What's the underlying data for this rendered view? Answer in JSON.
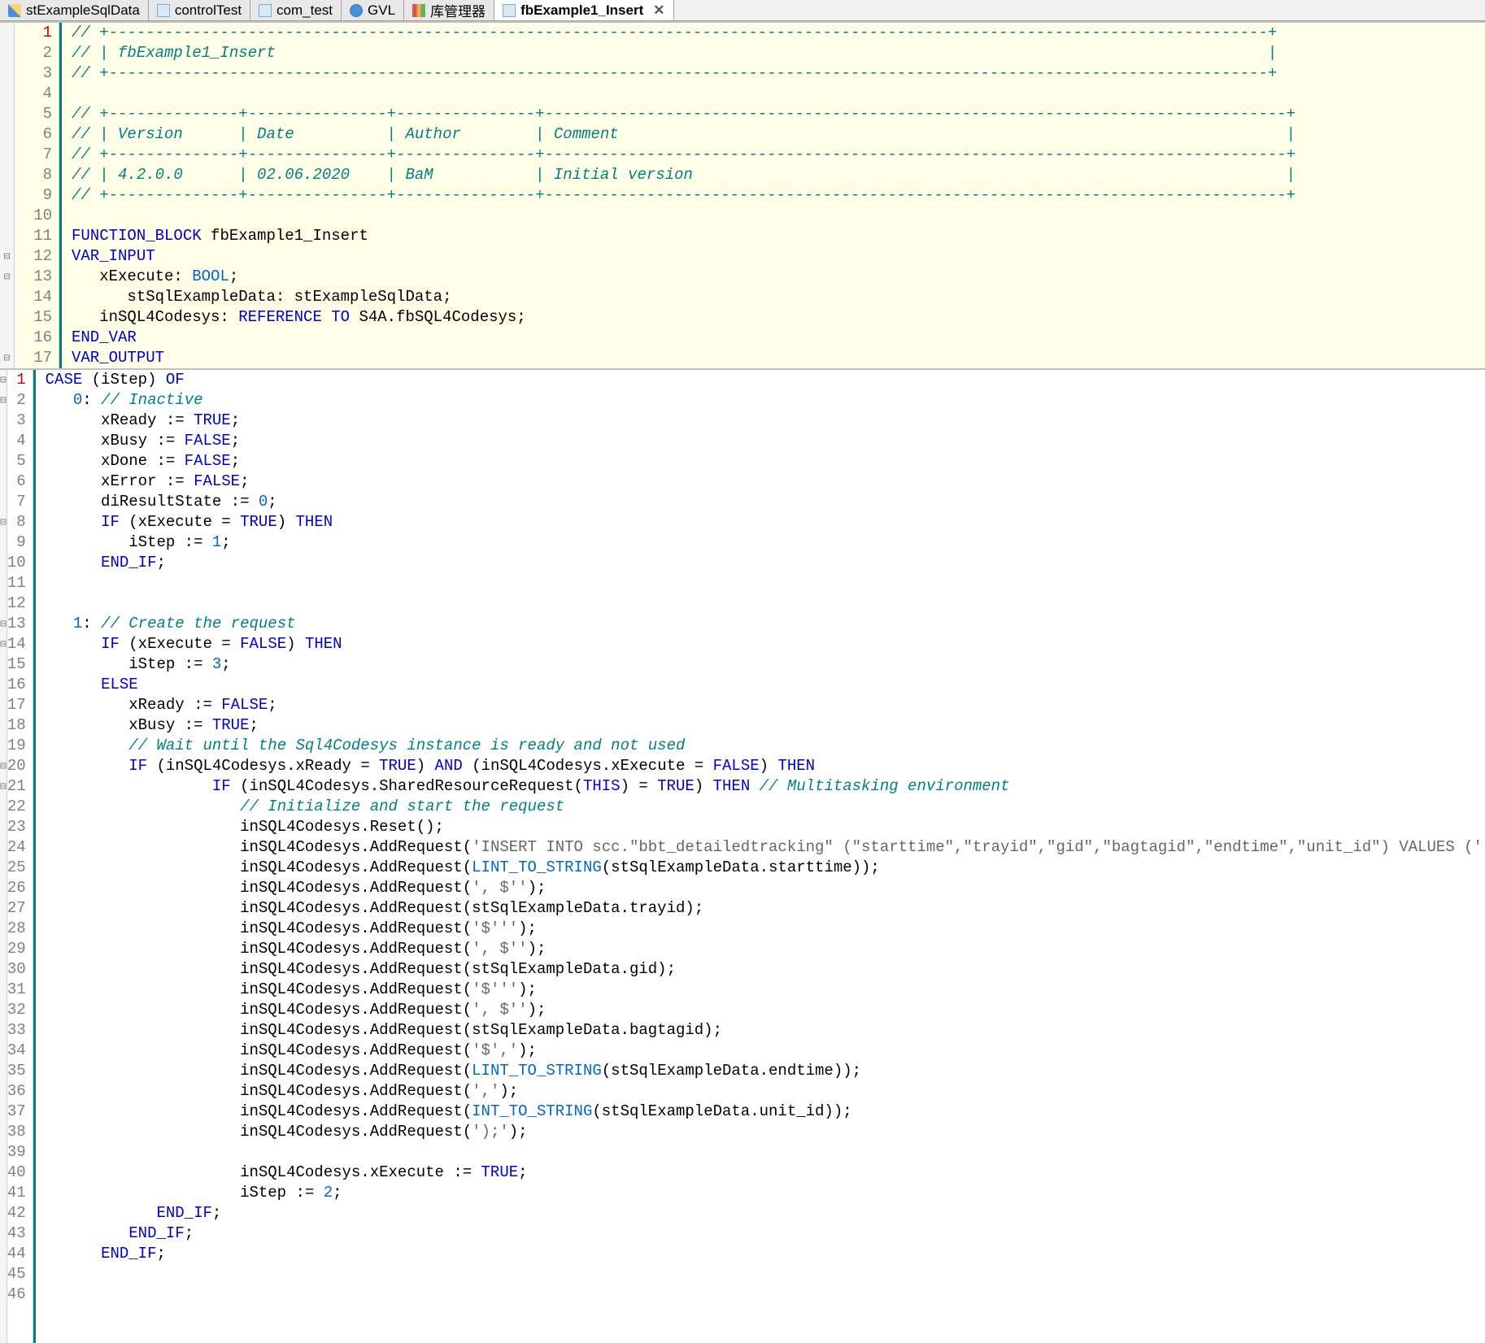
{
  "tabs": [
    {
      "label": "stExampleSqlData",
      "icon": "struct"
    },
    {
      "label": "controlTest",
      "icon": "file"
    },
    {
      "label": "com_test",
      "icon": "file"
    },
    {
      "label": "GVL",
      "icon": "globe"
    },
    {
      "label": "库管理器",
      "icon": "lib"
    },
    {
      "label": "fbExample1_Insert",
      "icon": "file",
      "active": true
    }
  ],
  "topPane": {
    "lines": [
      {
        "n": 1,
        "current": true,
        "fold": "",
        "tokens": [
          {
            "t": "// +-----------------------------------------------------------------------------------------------------------------------------+",
            "c": "comment-it"
          }
        ]
      },
      {
        "n": 2,
        "tokens": [
          {
            "t": "// | fbExample1_Insert                                                                                                           |",
            "c": "comment-it"
          }
        ]
      },
      {
        "n": 3,
        "tokens": [
          {
            "t": "// +-----------------------------------------------------------------------------------------------------------------------------+",
            "c": "comment-it"
          }
        ]
      },
      {
        "n": 4,
        "tokens": []
      },
      {
        "n": 5,
        "tokens": [
          {
            "t": "// +--------------+---------------+---------------+--------------------------------------------------------------------------------+",
            "c": "comment-it"
          }
        ]
      },
      {
        "n": 6,
        "tokens": [
          {
            "t": "// | Version      | Date          | Author        | Comment                                                                        |",
            "c": "comment-it"
          }
        ]
      },
      {
        "n": 7,
        "tokens": [
          {
            "t": "// +--------------+---------------+---------------+--------------------------------------------------------------------------------+",
            "c": "comment-it"
          }
        ]
      },
      {
        "n": 8,
        "tokens": [
          {
            "t": "// | 4.2.0.0      | 02.06.2020    | BaM           | Initial version                                                                |",
            "c": "comment-it"
          }
        ]
      },
      {
        "n": 9,
        "tokens": [
          {
            "t": "// +--------------+---------------+---------------+--------------------------------------------------------------------------------+",
            "c": "comment-it"
          }
        ]
      },
      {
        "n": 10,
        "tokens": []
      },
      {
        "n": 11,
        "tokens": [
          {
            "t": "FUNCTION_BLOCK",
            "c": "kw"
          },
          {
            "t": " fbExample1_Insert",
            "c": "plain"
          }
        ]
      },
      {
        "n": 12,
        "fold": "⊟",
        "tokens": [
          {
            "t": "VAR_INPUT",
            "c": "kw"
          }
        ]
      },
      {
        "n": 13,
        "fold": "⊟",
        "tokens": [
          {
            "t": "   xExecute: ",
            "c": "plain"
          },
          {
            "t": "BOOL",
            "c": "type"
          },
          {
            "t": ";",
            "c": "plain"
          }
        ]
      },
      {
        "n": 14,
        "tokens": [
          {
            "t": "      stSqlExampleData: stExampleSqlData;",
            "c": "plain"
          }
        ]
      },
      {
        "n": 15,
        "tokens": [
          {
            "t": "   inSQL4Codesys: ",
            "c": "plain"
          },
          {
            "t": "REFERENCE TO",
            "c": "kw"
          },
          {
            "t": " S4A.fbSQL4Codesys;",
            "c": "plain"
          }
        ]
      },
      {
        "n": 16,
        "tokens": [
          {
            "t": "END_VAR",
            "c": "kw"
          }
        ]
      },
      {
        "n": 17,
        "fold": "⊟",
        "tokens": [
          {
            "t": "VAR_OUTPUT",
            "c": "kw"
          }
        ]
      }
    ]
  },
  "bottomPane": {
    "lines": [
      {
        "n": 1,
        "current": true,
        "fold": "⊟",
        "tokens": [
          {
            "t": "CASE",
            "c": "kw"
          },
          {
            "t": " (iStep) ",
            "c": "plain"
          },
          {
            "t": "OF",
            "c": "kw"
          }
        ]
      },
      {
        "n": 2,
        "fold": "⊟",
        "tokens": [
          {
            "t": "   ",
            "c": "plain"
          },
          {
            "t": "0",
            "c": "num"
          },
          {
            "t": ": ",
            "c": "plain"
          },
          {
            "t": "// Inactive",
            "c": "comment-it"
          }
        ]
      },
      {
        "n": 3,
        "tokens": [
          {
            "t": "      xReady := ",
            "c": "plain"
          },
          {
            "t": "TRUE",
            "c": "bool"
          },
          {
            "t": ";",
            "c": "plain"
          }
        ]
      },
      {
        "n": 4,
        "tokens": [
          {
            "t": "      xBusy := ",
            "c": "plain"
          },
          {
            "t": "FALSE",
            "c": "bool"
          },
          {
            "t": ";",
            "c": "plain"
          }
        ]
      },
      {
        "n": 5,
        "tokens": [
          {
            "t": "      xDone := ",
            "c": "plain"
          },
          {
            "t": "FALSE",
            "c": "bool"
          },
          {
            "t": ";",
            "c": "plain"
          }
        ]
      },
      {
        "n": 6,
        "tokens": [
          {
            "t": "      xError := ",
            "c": "plain"
          },
          {
            "t": "FALSE",
            "c": "bool"
          },
          {
            "t": ";",
            "c": "plain"
          }
        ]
      },
      {
        "n": 7,
        "tokens": [
          {
            "t": "      diResultState := ",
            "c": "plain"
          },
          {
            "t": "0",
            "c": "num"
          },
          {
            "t": ";",
            "c": "plain"
          }
        ]
      },
      {
        "n": 8,
        "fold": "⊟",
        "tokens": [
          {
            "t": "      ",
            "c": "plain"
          },
          {
            "t": "IF",
            "c": "kw"
          },
          {
            "t": " (xExecute = ",
            "c": "plain"
          },
          {
            "t": "TRUE",
            "c": "bool"
          },
          {
            "t": ") ",
            "c": "plain"
          },
          {
            "t": "THEN",
            "c": "kw"
          }
        ]
      },
      {
        "n": 9,
        "tokens": [
          {
            "t": "         iStep := ",
            "c": "plain"
          },
          {
            "t": "1",
            "c": "num"
          },
          {
            "t": ";",
            "c": "plain"
          }
        ]
      },
      {
        "n": 10,
        "tokens": [
          {
            "t": "      ",
            "c": "plain"
          },
          {
            "t": "END_IF",
            "c": "kw"
          },
          {
            "t": ";",
            "c": "plain"
          }
        ]
      },
      {
        "n": 11,
        "tokens": []
      },
      {
        "n": 12,
        "tokens": []
      },
      {
        "n": 13,
        "fold": "⊟",
        "tokens": [
          {
            "t": "   ",
            "c": "plain"
          },
          {
            "t": "1",
            "c": "num"
          },
          {
            "t": ": ",
            "c": "plain"
          },
          {
            "t": "// Create the request",
            "c": "comment-it"
          }
        ]
      },
      {
        "n": 14,
        "fold": "⊟",
        "tokens": [
          {
            "t": "      ",
            "c": "plain"
          },
          {
            "t": "IF",
            "c": "kw"
          },
          {
            "t": " (xExecute = ",
            "c": "plain"
          },
          {
            "t": "FALSE",
            "c": "bool"
          },
          {
            "t": ") ",
            "c": "plain"
          },
          {
            "t": "THEN",
            "c": "kw"
          }
        ]
      },
      {
        "n": 15,
        "tokens": [
          {
            "t": "         iStep := ",
            "c": "plain"
          },
          {
            "t": "3",
            "c": "num"
          },
          {
            "t": ";",
            "c": "plain"
          }
        ]
      },
      {
        "n": 16,
        "tokens": [
          {
            "t": "      ",
            "c": "plain"
          },
          {
            "t": "ELSE",
            "c": "kw"
          }
        ]
      },
      {
        "n": 17,
        "tokens": [
          {
            "t": "         xReady := ",
            "c": "plain"
          },
          {
            "t": "FALSE",
            "c": "bool"
          },
          {
            "t": ";",
            "c": "plain"
          }
        ]
      },
      {
        "n": 18,
        "tokens": [
          {
            "t": "         xBusy := ",
            "c": "plain"
          },
          {
            "t": "TRUE",
            "c": "bool"
          },
          {
            "t": ";",
            "c": "plain"
          }
        ]
      },
      {
        "n": 19,
        "tokens": [
          {
            "t": "         ",
            "c": "plain"
          },
          {
            "t": "// Wait until the Sql4Codesys instance is ready and not used",
            "c": "comment-it"
          }
        ]
      },
      {
        "n": 20,
        "fold": "⊟",
        "tokens": [
          {
            "t": "         ",
            "c": "plain"
          },
          {
            "t": "IF",
            "c": "kw"
          },
          {
            "t": " (inSQL4Codesys.xReady = ",
            "c": "plain"
          },
          {
            "t": "TRUE",
            "c": "bool"
          },
          {
            "t": ") ",
            "c": "plain"
          },
          {
            "t": "AND",
            "c": "kw"
          },
          {
            "t": " (inSQL4Codesys.xExecute = ",
            "c": "plain"
          },
          {
            "t": "FALSE",
            "c": "bool"
          },
          {
            "t": ") ",
            "c": "plain"
          },
          {
            "t": "THEN",
            "c": "kw"
          }
        ]
      },
      {
        "n": 21,
        "fold": "⊟",
        "tokens": [
          {
            "t": "                  ",
            "c": "plain"
          },
          {
            "t": "IF",
            "c": "kw"
          },
          {
            "t": " (inSQL4Codesys.SharedResourceRequest(",
            "c": "plain"
          },
          {
            "t": "THIS",
            "c": "kw"
          },
          {
            "t": ") = ",
            "c": "plain"
          },
          {
            "t": "TRUE",
            "c": "bool"
          },
          {
            "t": ") ",
            "c": "plain"
          },
          {
            "t": "THEN",
            "c": "kw"
          },
          {
            "t": " ",
            "c": "plain"
          },
          {
            "t": "// Multitasking environment",
            "c": "comment-it"
          }
        ]
      },
      {
        "n": 22,
        "tokens": [
          {
            "t": "                     ",
            "c": "plain"
          },
          {
            "t": "// Initialize and start the request",
            "c": "comment-it"
          }
        ]
      },
      {
        "n": 23,
        "tokens": [
          {
            "t": "                     inSQL4Codesys.Reset();",
            "c": "plain"
          }
        ]
      },
      {
        "n": 24,
        "tokens": [
          {
            "t": "                     inSQL4Codesys.AddRequest(",
            "c": "plain"
          },
          {
            "t": "'INSERT INTO scc.\"bbt_detailedtracking\" (\"starttime\",\"trayid\",\"gid\",\"bagtagid\",\"endtime\",\"unit_id\") VALUES ('",
            "c": "str"
          },
          {
            "t": ");",
            "c": "plain"
          }
        ]
      },
      {
        "n": 25,
        "tokens": [
          {
            "t": "                     inSQL4Codesys.AddRequest(",
            "c": "plain"
          },
          {
            "t": "LINT_TO_STRING",
            "c": "func"
          },
          {
            "t": "(stSqlExampleData.starttime));",
            "c": "plain"
          }
        ]
      },
      {
        "n": 26,
        "tokens": [
          {
            "t": "                     inSQL4Codesys.AddRequest(",
            "c": "plain"
          },
          {
            "t": "', $''",
            "c": "str"
          },
          {
            "t": ");",
            "c": "plain"
          }
        ]
      },
      {
        "n": 27,
        "tokens": [
          {
            "t": "                     inSQL4Codesys.AddRequest(stSqlExampleData.trayid);",
            "c": "plain"
          }
        ]
      },
      {
        "n": 28,
        "tokens": [
          {
            "t": "                     inSQL4Codesys.AddRequest(",
            "c": "plain"
          },
          {
            "t": "'$'''",
            "c": "str"
          },
          {
            "t": ");",
            "c": "plain"
          }
        ]
      },
      {
        "n": 29,
        "tokens": [
          {
            "t": "                     inSQL4Codesys.AddRequest(",
            "c": "plain"
          },
          {
            "t": "', $''",
            "c": "str"
          },
          {
            "t": ");",
            "c": "plain"
          }
        ]
      },
      {
        "n": 30,
        "tokens": [
          {
            "t": "                     inSQL4Codesys.AddRequest(stSqlExampleData.gid);",
            "c": "plain"
          }
        ]
      },
      {
        "n": 31,
        "tokens": [
          {
            "t": "                     inSQL4Codesys.AddRequest(",
            "c": "plain"
          },
          {
            "t": "'$'''",
            "c": "str"
          },
          {
            "t": ");",
            "c": "plain"
          }
        ]
      },
      {
        "n": 32,
        "tokens": [
          {
            "t": "                     inSQL4Codesys.AddRequest(",
            "c": "plain"
          },
          {
            "t": "', $''",
            "c": "str"
          },
          {
            "t": ");",
            "c": "plain"
          }
        ]
      },
      {
        "n": 33,
        "tokens": [
          {
            "t": "                     inSQL4Codesys.AddRequest(stSqlExampleData.bagtagid);",
            "c": "plain"
          }
        ]
      },
      {
        "n": 34,
        "tokens": [
          {
            "t": "                     inSQL4Codesys.AddRequest(",
            "c": "plain"
          },
          {
            "t": "'$','",
            "c": "str"
          },
          {
            "t": ");",
            "c": "plain"
          }
        ]
      },
      {
        "n": 35,
        "tokens": [
          {
            "t": "                     inSQL4Codesys.AddRequest(",
            "c": "plain"
          },
          {
            "t": "LINT_TO_STRING",
            "c": "func"
          },
          {
            "t": "(stSqlExampleData.endtime));",
            "c": "plain"
          }
        ]
      },
      {
        "n": 36,
        "tokens": [
          {
            "t": "                     inSQL4Codesys.AddRequest(",
            "c": "plain"
          },
          {
            "t": "','",
            "c": "str"
          },
          {
            "t": ");",
            "c": "plain"
          }
        ]
      },
      {
        "n": 37,
        "tokens": [
          {
            "t": "                     inSQL4Codesys.AddRequest(",
            "c": "plain"
          },
          {
            "t": "INT_TO_STRING",
            "c": "func"
          },
          {
            "t": "(stSqlExampleData.unit_id));",
            "c": "plain"
          }
        ]
      },
      {
        "n": 38,
        "tokens": [
          {
            "t": "                     inSQL4Codesys.AddRequest(",
            "c": "plain"
          },
          {
            "t": "');'",
            "c": "str"
          },
          {
            "t": ");",
            "c": "plain"
          }
        ]
      },
      {
        "n": 39,
        "tokens": []
      },
      {
        "n": 40,
        "tokens": [
          {
            "t": "                     inSQL4Codesys.xExecute := ",
            "c": "plain"
          },
          {
            "t": "TRUE",
            "c": "bool"
          },
          {
            "t": ";",
            "c": "plain"
          }
        ]
      },
      {
        "n": 41,
        "tokens": [
          {
            "t": "                     iStep := ",
            "c": "plain"
          },
          {
            "t": "2",
            "c": "num"
          },
          {
            "t": ";",
            "c": "plain"
          }
        ]
      },
      {
        "n": 42,
        "tokens": [
          {
            "t": "            ",
            "c": "plain"
          },
          {
            "t": "END_IF",
            "c": "kw"
          },
          {
            "t": ";",
            "c": "plain"
          }
        ]
      },
      {
        "n": 43,
        "tokens": [
          {
            "t": "         ",
            "c": "plain"
          },
          {
            "t": "END_IF",
            "c": "kw"
          },
          {
            "t": ";",
            "c": "plain"
          }
        ]
      },
      {
        "n": 44,
        "tokens": [
          {
            "t": "      ",
            "c": "plain"
          },
          {
            "t": "END_IF",
            "c": "kw"
          },
          {
            "t": ";",
            "c": "plain"
          }
        ]
      },
      {
        "n": 45,
        "tokens": []
      },
      {
        "n": 46,
        "tokens": []
      }
    ]
  }
}
